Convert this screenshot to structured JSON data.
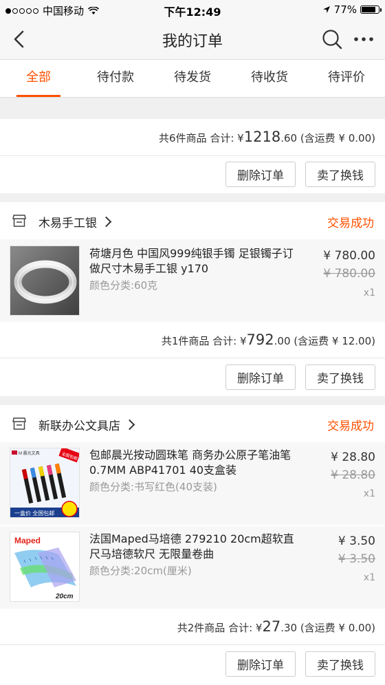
{
  "status_bar": {
    "carrier": "中国移动",
    "time": "下午12:49",
    "battery": "77%",
    "battery_level": 0.77
  },
  "nav": {
    "title": "我的订单"
  },
  "tabs": [
    {
      "label": "全部",
      "active": true
    },
    {
      "label": "待付款"
    },
    {
      "label": "待发货"
    },
    {
      "label": "待收货"
    },
    {
      "label": "待评价"
    }
  ],
  "orders": [
    {
      "summary_prefix": "共6件商品 合计: ¥",
      "total_int": "1218",
      "total_dec": ".60",
      "summary_suffix": " (含运费 ¥ 0.00)",
      "delete_label": "删除订单",
      "sell_label": "卖了换钱"
    },
    {
      "shop": "木易手工银",
      "status": "交易成功",
      "items": [
        {
          "title": "荷塘月色 中国风999纯银手镯 足银镯子订做尺寸木易手工银 y170",
          "sku": "颜色分类:60克",
          "price": "¥ 780.00",
          "old_price": "¥ 780.00",
          "qty": "x1"
        }
      ],
      "summary_prefix": "共1件商品 合计: ¥",
      "total_int": "792",
      "total_dec": ".00",
      "summary_suffix": " (含运费 ¥ 12.00)",
      "delete_label": "删除订单",
      "sell_label": "卖了换钱"
    },
    {
      "shop": "新联办公文具店",
      "status": "交易成功",
      "items": [
        {
          "title": "包邮晨光按动圆珠笔 商务办公原子笔油笔0.7MM ABP41701 40支盒装",
          "sku": "颜色分类:书写红色(40支装)",
          "price": "¥ 28.80",
          "old_price": "¥ 28.80",
          "qty": "x1",
          "thumb_brand": "M 晨光文具",
          "thumb_badge": "全国包邮",
          "thumb_caption": "一盒价 全国包邮"
        },
        {
          "title": "法国Maped马培德 279210 20cm超软直尺马培德软尺 无限量卷曲",
          "sku": "颜色分类:20cm(厘米)",
          "price": "¥ 3.50",
          "old_price": "¥ 3.50",
          "qty": "x1",
          "thumb_brand": "Maped",
          "thumb_caption": "20cm"
        }
      ],
      "summary_prefix": "共2件商品 合计: ¥",
      "total_int": "27",
      "total_dec": ".30",
      "summary_suffix": " (含运费 ¥ 0.00)",
      "delete_label": "删除订单",
      "sell_label": "卖了换钱"
    }
  ],
  "colors": {
    "accent": "#ff5000",
    "background": "#f0f0f0"
  }
}
